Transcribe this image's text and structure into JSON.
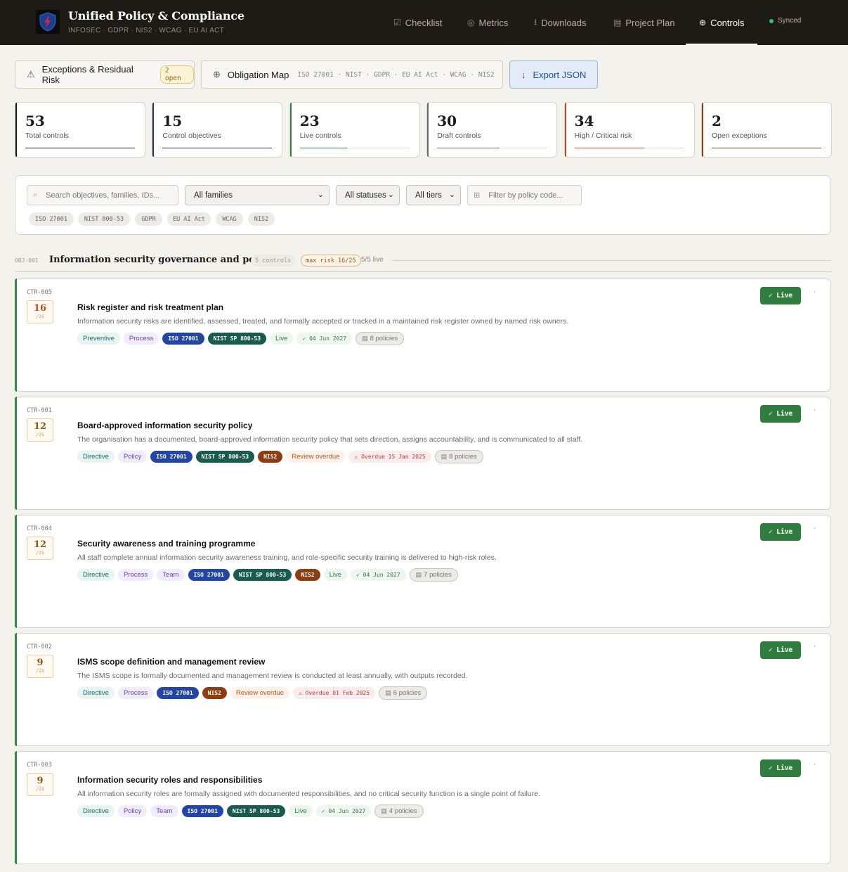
{
  "app": {
    "title": "Unified Policy & Compliance",
    "subtitle": "INFOSEC · GDPR · NIS2 · WCAG · EU AI ACT",
    "brand_color": "#1e1b17"
  },
  "nav": [
    {
      "label": "Checklist",
      "icon": "checkbox-icon"
    },
    {
      "label": "Metrics",
      "icon": "gauge-icon"
    },
    {
      "label": "Downloads",
      "icon": "download-icon"
    },
    {
      "label": "Project Plan",
      "icon": "clipboard-icon"
    },
    {
      "label": "Controls",
      "icon": "globe-icon",
      "active": true
    }
  ],
  "status": "Synced",
  "toolbar": {
    "exceptions_label": "Exceptions & Residual Risk",
    "exceptions_badge": "2 open",
    "obligation_label": "Obligation Map",
    "obligation_frameworks": "ISO 27001 · NIST · GDPR · EU AI Act · WCAG · NIS2",
    "export_label": "Export JSON"
  },
  "stats": [
    {
      "value": "53",
      "label": "Total controls",
      "color": "#1a1a1a",
      "progress": 1.0
    },
    {
      "value": "15",
      "label": "Control objectives",
      "color": "#24305e",
      "progress": 1.0
    },
    {
      "value": "23",
      "label": "Live controls",
      "color": "#2f7d3f",
      "progress": 0.43
    },
    {
      "value": "30",
      "label": "Draft controls",
      "color": "#6b6a66",
      "progress": 0.57
    },
    {
      "value": "34",
      "label": "High / Critical risk",
      "color": "#b5501a",
      "progress": 0.64
    },
    {
      "value": "2",
      "label": "Open exceptions",
      "color": "#8d3e10",
      "progress": 1.0
    }
  ],
  "filters": {
    "search_placeholder": "Search objectives, families, IDs...",
    "family_value": "All families",
    "status_value": "All statuses",
    "tier_value": "All tiers",
    "policy_placeholder": "Filter by policy code...",
    "chips": [
      "ISO 27001",
      "NIST 800-53",
      "GDPR",
      "EU AI Act",
      "WCAG",
      "NIS2"
    ]
  },
  "objective": {
    "id": "OBJ-001",
    "title": "Information security governance and policy",
    "count": "5 controls",
    "max_risk": "max risk 16/25",
    "live": "5/5 live"
  },
  "controls": [
    {
      "id": "CTR-005",
      "risk": "16",
      "risk_denom": "/25",
      "risk_color": "#b5501a",
      "title": "Risk register and risk treatment plan",
      "desc": "Information security risks are identified, assessed, treated, and formally accepted or tracked in a maintained risk register owned by named risk owners.",
      "status": "✓ Live",
      "tags": [
        {
          "text": "Preventive",
          "cls": "t-teal"
        },
        {
          "text": "Process",
          "cls": "t-purple"
        },
        {
          "text": "ISO 27001",
          "cls": "t-iso"
        },
        {
          "text": "NIST SP 800-53",
          "cls": "t-nist"
        },
        {
          "text": "Live",
          "cls": "t-live"
        },
        {
          "text": "✓ 04 Jun 2027",
          "cls": "t-date"
        },
        {
          "text": "8 policies",
          "cls": "t-pol",
          "icon": true
        }
      ]
    },
    {
      "id": "CTR-001",
      "risk": "12",
      "risk_denom": "/25",
      "risk_color": "#8a5a10",
      "title": "Board-approved information security policy",
      "desc": "The organisation has a documented, board-approved information security policy that sets direction, assigns accountability, and is communicated to all staff.",
      "status": "✓ Live",
      "tags": [
        {
          "text": "Directive",
          "cls": "t-teal"
        },
        {
          "text": "Policy",
          "cls": "t-purple"
        },
        {
          "text": "ISO 27001",
          "cls": "t-iso"
        },
        {
          "text": "NIST SP 800-53",
          "cls": "t-nist"
        },
        {
          "text": "NIS2",
          "cls": "t-nis2"
        },
        {
          "text": "Review overdue",
          "cls": "t-overdue"
        },
        {
          "text": "⚠ Overdue 15 Jan 2025",
          "cls": "t-odate"
        },
        {
          "text": "8 policies",
          "cls": "t-pol",
          "icon": true
        }
      ]
    },
    {
      "id": "CTR-004",
      "risk": "12",
      "risk_denom": "/25",
      "risk_color": "#8a5a10",
      "title": "Security awareness and training programme",
      "desc": "All staff complete annual information security awareness training, and role-specific security training is delivered to high-risk roles.",
      "status": "✓ Live",
      "tags": [
        {
          "text": "Directive",
          "cls": "t-teal"
        },
        {
          "text": "Process",
          "cls": "t-purple"
        },
        {
          "text": "Team",
          "cls": "t-purple"
        },
        {
          "text": "ISO 27001",
          "cls": "t-iso"
        },
        {
          "text": "NIST SP 800-53",
          "cls": "t-nist"
        },
        {
          "text": "NIS2",
          "cls": "t-nis2"
        },
        {
          "text": "Live",
          "cls": "t-live"
        },
        {
          "text": "✓ 04 Jun 2027",
          "cls": "t-date"
        },
        {
          "text": "7 policies",
          "cls": "t-pol",
          "icon": true
        }
      ]
    },
    {
      "id": "CTR-002",
      "risk": "9",
      "risk_denom": "/25",
      "risk_color": "#8a5a10",
      "title": "ISMS scope definition and management review",
      "desc": "The ISMS scope is formally documented and management review is conducted at least annually, with outputs recorded.",
      "status": "✓ Live",
      "tags": [
        {
          "text": "Directive",
          "cls": "t-teal"
        },
        {
          "text": "Process",
          "cls": "t-purple"
        },
        {
          "text": "ISO 27001",
          "cls": "t-iso"
        },
        {
          "text": "NIS2",
          "cls": "t-nis2"
        },
        {
          "text": "Review overdue",
          "cls": "t-overdue"
        },
        {
          "text": "⚠ Overdue 01 Feb 2025",
          "cls": "t-odate"
        },
        {
          "text": "6 policies",
          "cls": "t-pol",
          "icon": true
        }
      ]
    },
    {
      "id": "CTR-003",
      "risk": "9",
      "risk_denom": "/25",
      "risk_color": "#8a5a10",
      "title": "Information security roles and responsibilities",
      "desc": "All information security roles are formally assigned with documented responsibilities, and no critical security function is a single point of failure.",
      "status": "✓ Live",
      "tags": [
        {
          "text": "Directive",
          "cls": "t-teal"
        },
        {
          "text": "Policy",
          "cls": "t-purple"
        },
        {
          "text": "Team",
          "cls": "t-purple"
        },
        {
          "text": "ISO 27001",
          "cls": "t-iso"
        },
        {
          "text": "NIST SP 800-53",
          "cls": "t-nist"
        },
        {
          "text": "Live",
          "cls": "t-live"
        },
        {
          "text": "✓ 04 Jun 2027",
          "cls": "t-date"
        },
        {
          "text": "4 policies",
          "cls": "t-pol",
          "icon": true
        }
      ]
    }
  ]
}
